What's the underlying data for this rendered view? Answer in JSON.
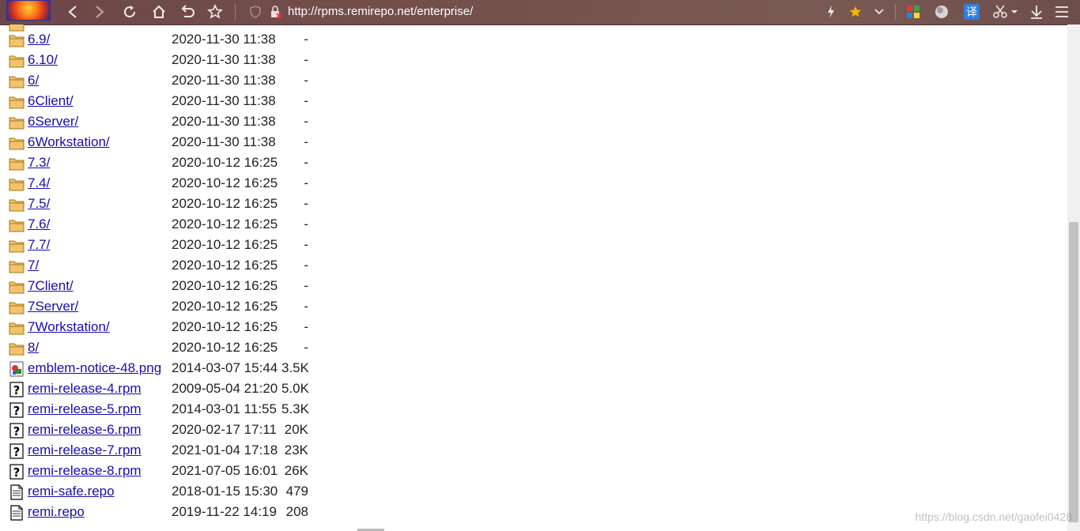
{
  "toolbar": {
    "url": "http://rpms.remirepo.net/enterprise/",
    "colors": {
      "bar": "#74504c",
      "star": "#f5b400",
      "translate_bg": "#2f7fe0"
    }
  },
  "listing": {
    "rows": [
      {
        "name": "6.9/",
        "date": "2020-11-30 11:38",
        "size": "-",
        "icon": "folder-icon"
      },
      {
        "name": "6.10/",
        "date": "2020-11-30 11:38",
        "size": "-",
        "icon": "folder-icon"
      },
      {
        "name": "6/",
        "date": "2020-11-30 11:38",
        "size": "-",
        "icon": "folder-icon"
      },
      {
        "name": "6Client/",
        "date": "2020-11-30 11:38",
        "size": "-",
        "icon": "folder-icon"
      },
      {
        "name": "6Server/",
        "date": "2020-11-30 11:38",
        "size": "-",
        "icon": "folder-icon"
      },
      {
        "name": "6Workstation/",
        "date": "2020-11-30 11:38",
        "size": "-",
        "icon": "folder-icon"
      },
      {
        "name": "7.3/",
        "date": "2020-10-12 16:25",
        "size": "-",
        "icon": "folder-icon"
      },
      {
        "name": "7.4/",
        "date": "2020-10-12 16:25",
        "size": "-",
        "icon": "folder-icon"
      },
      {
        "name": "7.5/",
        "date": "2020-10-12 16:25",
        "size": "-",
        "icon": "folder-icon"
      },
      {
        "name": "7.6/",
        "date": "2020-10-12 16:25",
        "size": "-",
        "icon": "folder-icon"
      },
      {
        "name": "7.7/",
        "date": "2020-10-12 16:25",
        "size": "-",
        "icon": "folder-icon"
      },
      {
        "name": "7/",
        "date": "2020-10-12 16:25",
        "size": "-",
        "icon": "folder-icon"
      },
      {
        "name": "7Client/",
        "date": "2020-10-12 16:25",
        "size": "-",
        "icon": "folder-icon"
      },
      {
        "name": "7Server/",
        "date": "2020-10-12 16:25",
        "size": "-",
        "icon": "folder-icon"
      },
      {
        "name": "7Workstation/",
        "date": "2020-10-12 16:25",
        "size": "-",
        "icon": "folder-icon"
      },
      {
        "name": "8/",
        "date": "2020-10-12 16:25",
        "size": "-",
        "icon": "folder-icon"
      },
      {
        "name": "emblem-notice-48.png",
        "date": "2014-03-07 15:44",
        "size": "3.5K",
        "icon": "image-icon"
      },
      {
        "name": "remi-release-4.rpm",
        "date": "2009-05-04 21:20",
        "size": "5.0K",
        "icon": "unknown-file-icon"
      },
      {
        "name": "remi-release-5.rpm",
        "date": "2014-03-01 11:55",
        "size": "5.3K",
        "icon": "unknown-file-icon"
      },
      {
        "name": "remi-release-6.rpm",
        "date": "2020-02-17 17:11",
        "size": "20K",
        "icon": "unknown-file-icon"
      },
      {
        "name": "remi-release-7.rpm",
        "date": "2021-01-04 17:18",
        "size": "23K",
        "icon": "unknown-file-icon"
      },
      {
        "name": "remi-release-8.rpm",
        "date": "2021-07-05 16:01",
        "size": "26K",
        "icon": "unknown-file-icon"
      },
      {
        "name": "remi-safe.repo",
        "date": "2018-01-15 15:30",
        "size": "479",
        "icon": "text-file-icon"
      },
      {
        "name": "remi.repo",
        "date": "2019-11-22 14:19",
        "size": "208",
        "icon": "text-file-icon"
      }
    ]
  },
  "watermark": "https://blog.csdn.net/gaofei0428"
}
